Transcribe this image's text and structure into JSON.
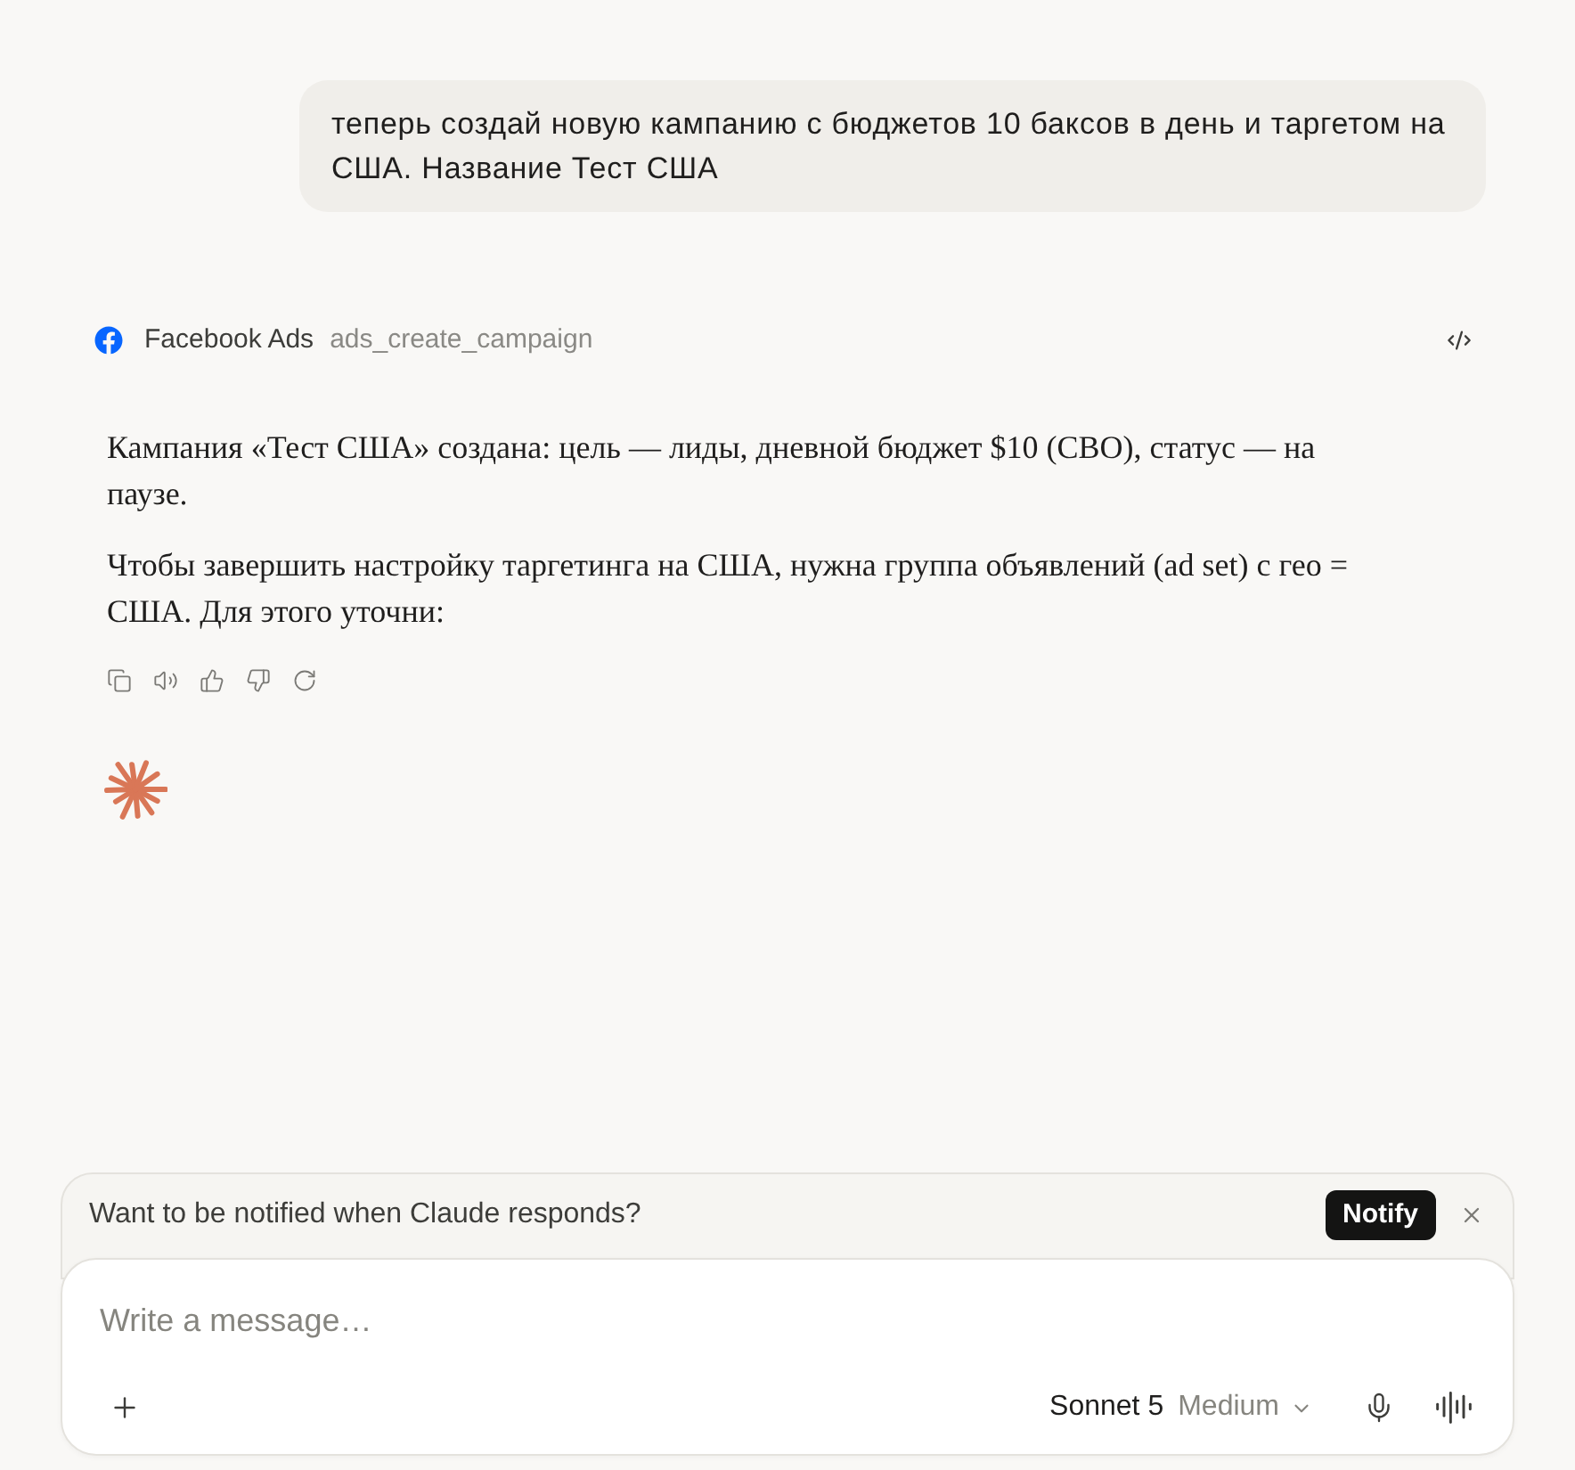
{
  "user_message": {
    "text": "теперь создай новую кампанию с бюджетов 10 баксов в день и таргетом на США. Название Тест США"
  },
  "tool_call": {
    "service": "Facebook Ads",
    "tool": "ads_create_campaign"
  },
  "assistant_message": {
    "paragraphs": [
      "Кампания «Тест США» создана: цель — лиды, дневной бюджет $10 (CBO), статус — на паузе.",
      "Чтобы завершить настройку таргетинга на США, нужна группа объявлений (ad set) с гео = США. Для этого уточни:"
    ]
  },
  "composer": {
    "notification": {
      "text": "Want to be notified when Claude responds?",
      "button": "Notify"
    },
    "input": {
      "placeholder": "Write a message…"
    },
    "model": "Sonnet 5",
    "effort": "Medium"
  }
}
